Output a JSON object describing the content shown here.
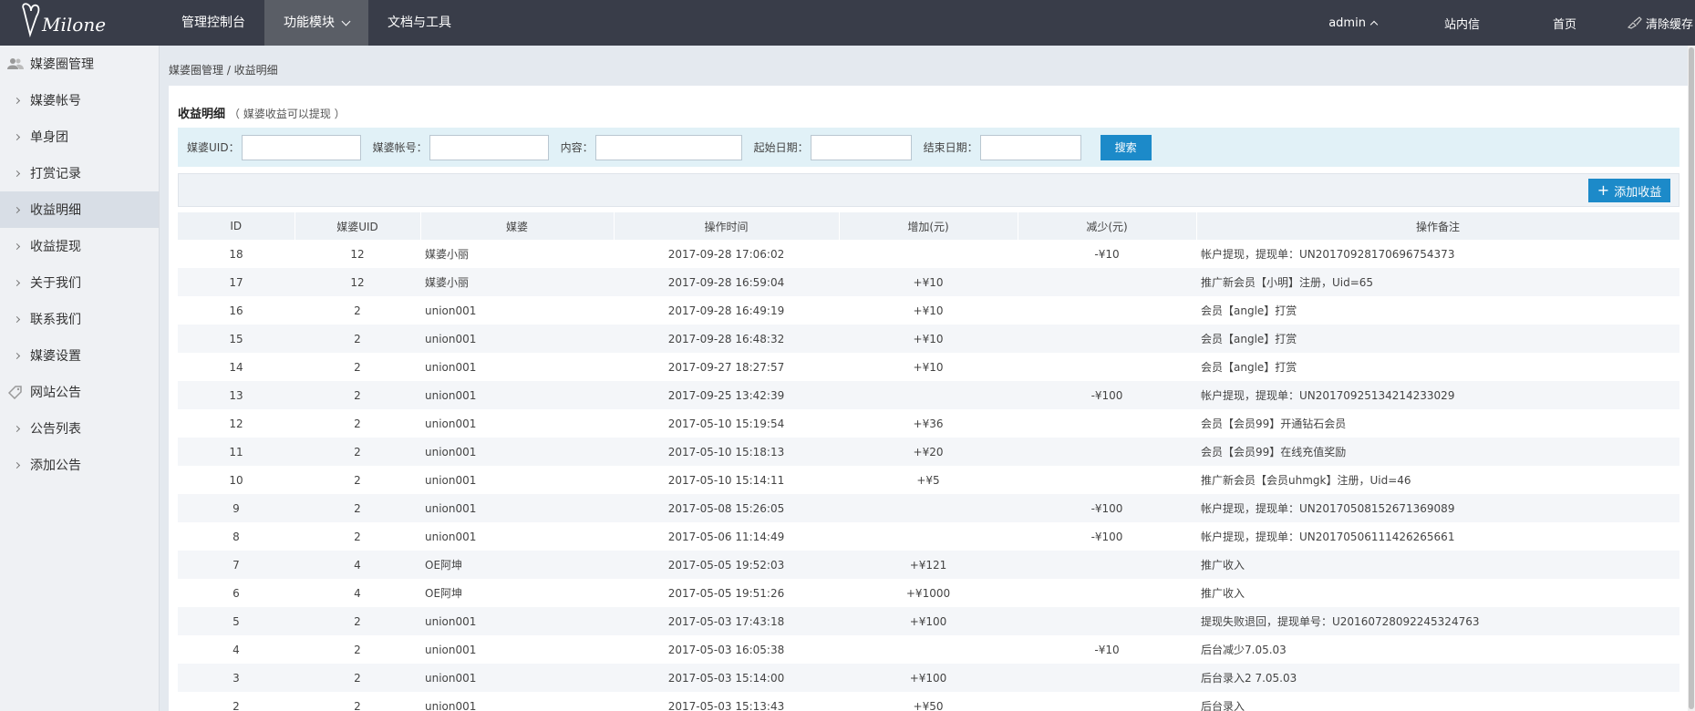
{
  "brand": {
    "logo_text": "Milone"
  },
  "topnav": {
    "items": [
      {
        "label": "管理控制台"
      },
      {
        "label": "功能模块"
      },
      {
        "label": "文档与工具"
      }
    ],
    "admin": "admin",
    "messages": "站内信",
    "home": "首页",
    "clear_cache": "清除缓存"
  },
  "sidebar": {
    "groups": [
      {
        "label": "媒婆圈管理",
        "icon": "users-icon",
        "items": [
          {
            "label": "媒婆帐号"
          },
          {
            "label": "单身团"
          },
          {
            "label": "打赏记录"
          },
          {
            "label": "收益明细"
          },
          {
            "label": "收益提现"
          },
          {
            "label": "关于我们"
          },
          {
            "label": "联系我们"
          },
          {
            "label": "媒婆设置"
          }
        ]
      },
      {
        "label": "网站公告",
        "icon": "tag-icon",
        "items": [
          {
            "label": "公告列表"
          },
          {
            "label": "添加公告"
          }
        ]
      }
    ]
  },
  "breadcrumb": "媒婆圈管理 / 收益明细",
  "panel": {
    "title": "收益明细",
    "subtitle": "（ 媒婆收益可以提现 ）"
  },
  "filter": {
    "uid_label": "媒婆UID：",
    "account_label": "媒婆帐号：",
    "content_label": "内容：",
    "start_label": "起始日期：",
    "end_label": "结束日期：",
    "search_button": "搜索"
  },
  "toolbar": {
    "add_button": "添加收益"
  },
  "table": {
    "headers": [
      "ID",
      "媒婆UID",
      "媒婆",
      "操作时间",
      "增加(元)",
      "减少(元)",
      "操作备注"
    ],
    "rows": [
      [
        "18",
        "12",
        "媒婆小丽",
        "2017-09-28 17:06:02",
        "",
        "-¥10",
        "帐户提现，提现单：UN20170928170696754373"
      ],
      [
        "17",
        "12",
        "媒婆小丽",
        "2017-09-28 16:59:04",
        "+¥10",
        "",
        "推广新会员【小明】注册，Uid=65"
      ],
      [
        "16",
        "2",
        "union001",
        "2017-09-28 16:49:19",
        "+¥10",
        "",
        "会员【angle】打赏"
      ],
      [
        "15",
        "2",
        "union001",
        "2017-09-28 16:48:32",
        "+¥10",
        "",
        "会员【angle】打赏"
      ],
      [
        "14",
        "2",
        "union001",
        "2017-09-27 18:27:57",
        "+¥10",
        "",
        "会员【angle】打赏"
      ],
      [
        "13",
        "2",
        "union001",
        "2017-09-25 13:42:39",
        "",
        "-¥100",
        "帐户提现，提现单：UN20170925134214233029"
      ],
      [
        "12",
        "2",
        "union001",
        "2017-05-10 15:19:54",
        "+¥36",
        "",
        "会员【会员99】开通钻石会员"
      ],
      [
        "11",
        "2",
        "union001",
        "2017-05-10 15:18:13",
        "+¥20",
        "",
        "会员【会员99】在线充值奖励"
      ],
      [
        "10",
        "2",
        "union001",
        "2017-05-10 15:14:11",
        "+¥5",
        "",
        "推广新会员【会员uhmgk】注册，Uid=46"
      ],
      [
        "9",
        "2",
        "union001",
        "2017-05-08 15:26:05",
        "",
        "-¥100",
        "帐户提现，提现单：UN20170508152671369089"
      ],
      [
        "8",
        "2",
        "union001",
        "2017-05-06 11:14:49",
        "",
        "-¥100",
        "帐户提现，提现单：UN20170506111426265661"
      ],
      [
        "7",
        "4",
        "OE阿坤",
        "2017-05-05 19:52:03",
        "+¥121",
        "",
        "推广收入"
      ],
      [
        "6",
        "4",
        "OE阿坤",
        "2017-05-05 19:51:26",
        "+¥1000",
        "",
        "推广收入"
      ],
      [
        "5",
        "2",
        "union001",
        "2017-05-03 17:43:18",
        "+¥100",
        "",
        "提现失败退回，提现单号：U20160728092245324763"
      ],
      [
        "4",
        "2",
        "union001",
        "2017-05-03 16:05:38",
        "",
        "-¥10",
        "后台减少7.05.03"
      ],
      [
        "3",
        "2",
        "union001",
        "2017-05-03 15:14:00",
        "+¥100",
        "",
        "后台录入2 7.05.03"
      ],
      [
        "2",
        "2",
        "union001",
        "2017-05-03 15:13:43",
        "+¥50",
        "",
        "后台录入"
      ]
    ]
  },
  "colors": {
    "topbar": "#393d49",
    "accent": "#1c8ac9",
    "increase": "#e02020",
    "decrease": "#3a8a27"
  }
}
